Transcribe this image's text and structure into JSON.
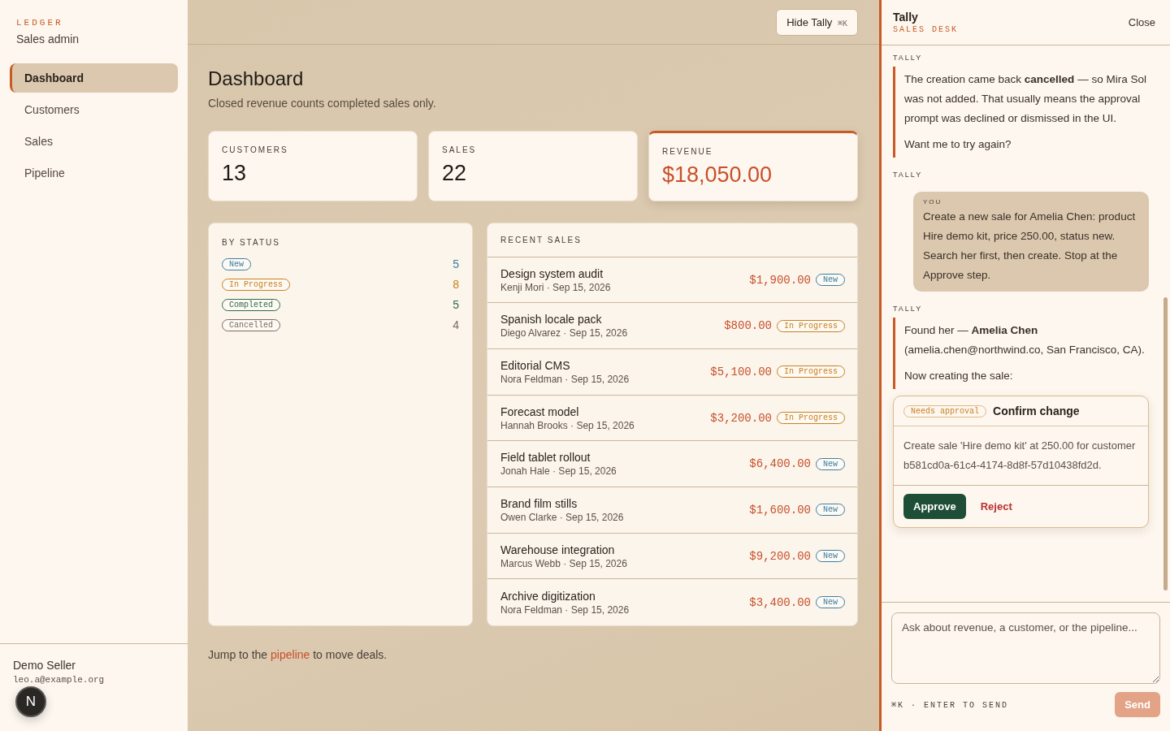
{
  "brand": {
    "eyebrow": "LEDGER",
    "title": "Sales admin"
  },
  "nav": [
    {
      "label": "Dashboard",
      "selected": true
    },
    {
      "label": "Customers",
      "selected": false
    },
    {
      "label": "Sales",
      "selected": false
    },
    {
      "label": "Pipeline",
      "selected": false
    }
  ],
  "user": {
    "name": "Demo Seller",
    "email": "leo.a@example.org"
  },
  "dev_badge": "N",
  "toolbar": {
    "button": "Hide Tally",
    "shortcut": "⌘K"
  },
  "page": {
    "title": "Dashboard",
    "subtitle": "Closed revenue counts completed sales only."
  },
  "stats": [
    {
      "label": "CUSTOMERS",
      "value": "13",
      "highlighted": false
    },
    {
      "label": "SALES",
      "value": "22",
      "highlighted": false
    },
    {
      "label": "REVENUE",
      "value": "$18,050.00",
      "highlighted": true
    }
  ],
  "by_status": {
    "title": "BY STATUS",
    "items": [
      {
        "status": "New",
        "count": "5",
        "color": "#3b7ea1"
      },
      {
        "status": "In Progress",
        "count": "8",
        "color": "#c9801f"
      },
      {
        "status": "Completed",
        "count": "5",
        "color": "#2f6b4f"
      },
      {
        "status": "Cancelled",
        "count": "4",
        "color": "#7a6a5e"
      }
    ]
  },
  "recent_sales": {
    "title": "RECENT SALES",
    "rows": [
      {
        "title": "Design system audit",
        "meta": "Kenji Mori · Sep 15, 2026",
        "amount": "$1,900.00",
        "status": "New",
        "color": "#3b7ea1"
      },
      {
        "title": "Spanish locale pack",
        "meta": "Diego Alvarez · Sep 15, 2026",
        "amount": "$800.00",
        "status": "In Progress",
        "color": "#c9801f"
      },
      {
        "title": "Editorial CMS",
        "meta": "Nora Feldman · Sep 15, 2026",
        "amount": "$5,100.00",
        "status": "In Progress",
        "color": "#c9801f"
      },
      {
        "title": "Forecast model",
        "meta": "Hannah Brooks · Sep 15, 2026",
        "amount": "$3,200.00",
        "status": "In Progress",
        "color": "#c9801f"
      },
      {
        "title": "Field tablet rollout",
        "meta": "Jonah Hale · Sep 15, 2026",
        "amount": "$6,400.00",
        "status": "New",
        "color": "#3b7ea1"
      },
      {
        "title": "Brand film stills",
        "meta": "Owen Clarke · Sep 15, 2026",
        "amount": "$1,600.00",
        "status": "New",
        "color": "#3b7ea1"
      },
      {
        "title": "Warehouse integration",
        "meta": "Marcus Webb · Sep 15, 2026",
        "amount": "$9,200.00",
        "status": "New",
        "color": "#3b7ea1"
      },
      {
        "title": "Archive digitization",
        "meta": "Nora Feldman · Sep 15, 2026",
        "amount": "$3,400.00",
        "status": "New",
        "color": "#3b7ea1"
      }
    ]
  },
  "footer_note": {
    "before": "Jump to the",
    "link": "pipeline",
    "after": "to move deals."
  },
  "chat": {
    "title": "Tally",
    "subtitle": "SALES DESK",
    "close": "Close",
    "messages": [
      {
        "kind": "assistant",
        "author": "TALLY",
        "paragraphs": [
          "The creation came back **cancelled** — so Mira Sol was not added. That usually means the approval prompt was declined or dismissed in the UI.",
          "Want me to try again?"
        ]
      },
      {
        "kind": "user",
        "label": "TALLY",
        "author": "YOU",
        "paragraphs": [
          "Create a new sale for Amelia Chen: product Hire demo kit, price 250.00, status new. Search her first, then create. Stop at the Approve step."
        ]
      },
      {
        "kind": "assistant",
        "author": "TALLY",
        "paragraphs": [
          "Found her — **Amelia Chen** (amelia.chen@northwind.co, San Francisco, CA).",
          "Now creating the sale:"
        ],
        "approval": {
          "badge": "Needs approval",
          "title": "Confirm change",
          "body": "Create sale 'Hire demo kit' at 250.00 for customer b581cd0a-61c4-4174-8d8f-57d10438fd2d.",
          "approve": "Approve",
          "reject": "Reject"
        }
      }
    ],
    "composer": {
      "placeholder": "Ask about revenue, a customer, or the pipeline...",
      "hint": "⌘K · ENTER TO SEND",
      "send": "Send"
    }
  }
}
